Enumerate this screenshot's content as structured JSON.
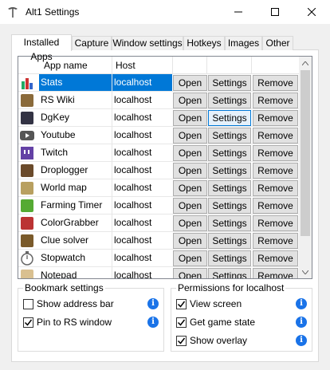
{
  "window": {
    "title": "Alt1 Settings",
    "icons": {
      "app": "pickaxe-icon",
      "minimize": "minimize-icon",
      "maximize": "maximize-icon",
      "close": "close-icon"
    }
  },
  "tabs": [
    {
      "label": "Installed Apps",
      "active": true
    },
    {
      "label": "Capture"
    },
    {
      "label": "Window settings"
    },
    {
      "label": "Hotkeys"
    },
    {
      "label": "Images"
    },
    {
      "label": "Other"
    }
  ],
  "grid": {
    "columns": {
      "name": "App name",
      "host": "Host"
    },
    "buttons": {
      "open": "Open",
      "settings": "Settings",
      "remove": "Remove"
    },
    "rows": [
      {
        "name": "Stats",
        "host": "localhost",
        "icon": "stats-icon",
        "selected": true
      },
      {
        "name": "RS Wiki",
        "host": "localhost",
        "icon": "rs-wiki-icon"
      },
      {
        "name": "DgKey",
        "host": "localhost",
        "icon": "dgkey-icon"
      },
      {
        "name": "Youtube",
        "host": "localhost",
        "icon": "youtube-icon"
      },
      {
        "name": "Twitch",
        "host": "localhost",
        "icon": "twitch-icon"
      },
      {
        "name": "Droplogger",
        "host": "localhost",
        "icon": "droplogger-icon"
      },
      {
        "name": "World map",
        "host": "localhost",
        "icon": "world-map-icon"
      },
      {
        "name": "Farming Timer",
        "host": "localhost",
        "icon": "farming-timer-icon"
      },
      {
        "name": "ColorGrabber",
        "host": "localhost",
        "icon": "color-grabber-icon"
      },
      {
        "name": "Clue solver",
        "host": "localhost",
        "icon": "clue-solver-icon"
      },
      {
        "name": "Stopwatch",
        "host": "localhost",
        "icon": "stopwatch-icon"
      },
      {
        "name": "Notepad",
        "host": "localhost",
        "icon": "notepad-icon"
      }
    ]
  },
  "bookmark": {
    "title": "Bookmark settings",
    "options": [
      {
        "label": "Show address bar",
        "checked": false
      },
      {
        "label": "Pin to RS window",
        "checked": true
      }
    ]
  },
  "permissions": {
    "title": "Permissions for localhost",
    "options": [
      {
        "label": "View screen",
        "checked": true
      },
      {
        "label": "Get game state",
        "checked": true
      },
      {
        "label": "Show overlay",
        "checked": true
      }
    ]
  },
  "colors": {
    "selection": "#0078d7",
    "info": "#1a73e8",
    "focus_border": "#0078d7"
  }
}
